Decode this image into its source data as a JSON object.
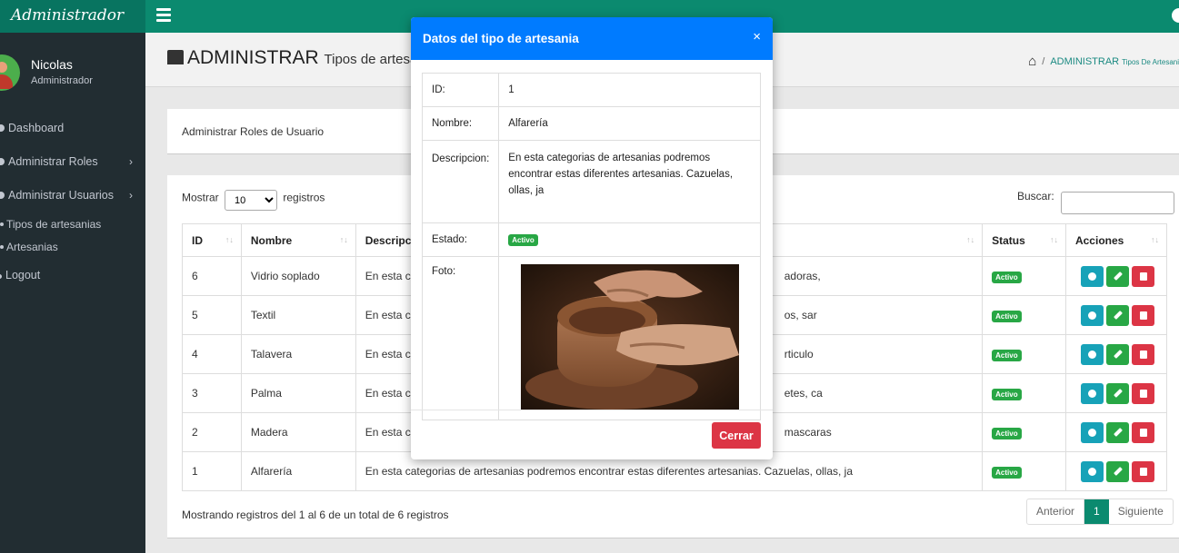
{
  "app": {
    "brand": "Administrador"
  },
  "user": {
    "name": "Nicolas",
    "role": "Administrador"
  },
  "sidebar": {
    "items": [
      {
        "label": "Dashboard",
        "icon": "dashboard-icon"
      },
      {
        "label": "Administrar Roles",
        "icon": "roles-icon"
      },
      {
        "label": "Administrar Usuarios",
        "icon": "users-icon"
      }
    ],
    "sub_items": [
      {
        "label": "Tipos de artesanias"
      },
      {
        "label": "Artesanias"
      }
    ],
    "logout": "Logout"
  },
  "header": {
    "title": "ADMINISTRAR",
    "subtitle": "Tipos de artesan",
    "breadcrumb_main": "ADMINISTRAR",
    "breadcrumb_sub": "Tipos De Artesani"
  },
  "card1": {
    "text": "Administrar Roles de Usuario"
  },
  "table_controls": {
    "show_label": "Mostrar",
    "show_value": "10",
    "records_label": "registros",
    "search_label": "Buscar:"
  },
  "table": {
    "columns": [
      "ID",
      "Nombre",
      "Descripcio",
      "Status",
      "Acciones"
    ],
    "rows": [
      {
        "id": "6",
        "nombre": "Vidrio soplado",
        "desc_left": "En esta cat",
        "desc_right": "adoras,",
        "status": "Activo"
      },
      {
        "id": "5",
        "nombre": "Textil",
        "desc_left": "En esta cat",
        "desc_right": "os, sar",
        "status": "Activo"
      },
      {
        "id": "4",
        "nombre": "Talavera",
        "desc_left": "En esta cat",
        "desc_right": "rticulo",
        "status": "Activo"
      },
      {
        "id": "3",
        "nombre": "Palma",
        "desc_left": "En esta cat",
        "desc_right": "etes, ca",
        "status": "Activo"
      },
      {
        "id": "2",
        "nombre": "Madera",
        "desc_left": "En esta cat",
        "desc_right": "mascaras",
        "status": "Activo"
      },
      {
        "id": "1",
        "nombre": "Alfarería",
        "desc_left": "En esta categorias de artesanias podremos encontrar estas diferentes artesanias. Cazuelas, ollas, ja",
        "desc_right": "",
        "status": "Activo"
      }
    ]
  },
  "footer": {
    "info": "Mostrando registros del 1 al 6 de un total de 6 registros",
    "prev": "Anterior",
    "page": "1",
    "next": "Siguiente"
  },
  "modal": {
    "title": "Datos del tipo de artesania",
    "close_symbol": "×",
    "labels": {
      "id": "ID:",
      "nombre": "Nombre:",
      "descripcion": "Descripcion:",
      "estado": "Estado:",
      "foto": "Foto:"
    },
    "values": {
      "id": "1",
      "nombre": "Alfarería",
      "descripcion": "En esta categorias de artesanias podremos encontrar estas diferentes artesanias. Cazuelas, ollas, ja",
      "estado": "Activo"
    },
    "close_button": "Cerrar"
  },
  "colors": {
    "topbar": "#0b8a6f",
    "sidebar": "#222d32",
    "modal_header": "#007bff",
    "danger": "#dc3545",
    "success": "#28a745",
    "info": "#17a2b8"
  }
}
